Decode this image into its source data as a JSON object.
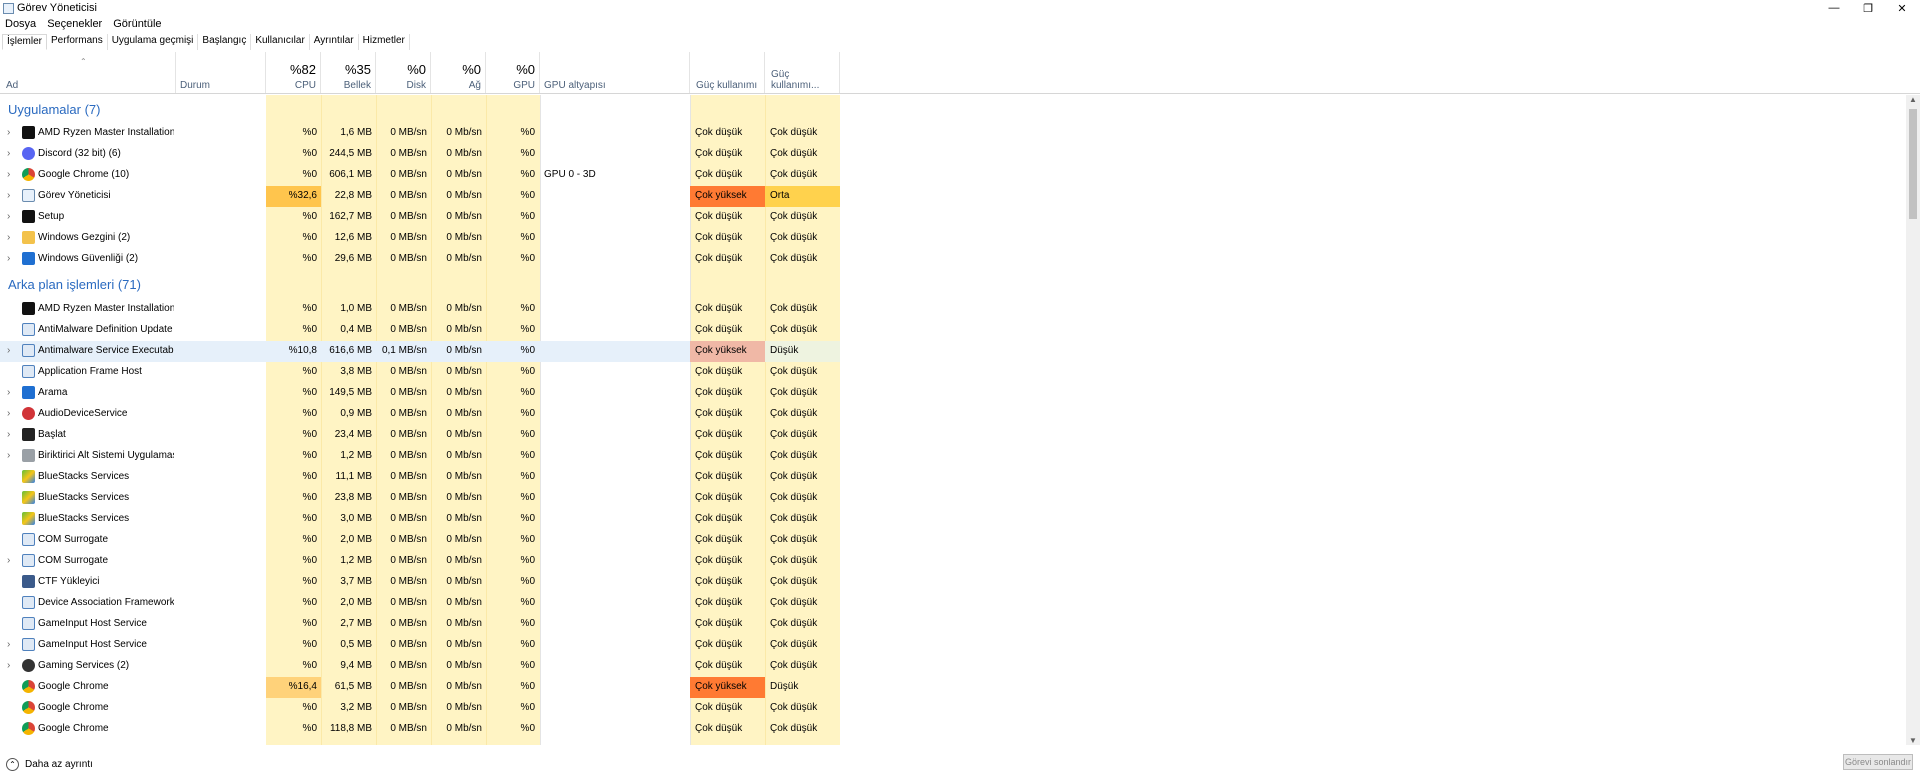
{
  "window": {
    "title": "Görev Yöneticisi",
    "minimize": "—",
    "restore": "❐",
    "close": "✕"
  },
  "menu": [
    "Dosya",
    "Seçenekler",
    "Görüntüle"
  ],
  "tabs": [
    "İşlemler",
    "Performans",
    "Uygulama geçmişi",
    "Başlangıç",
    "Kullanıcılar",
    "Ayrıntılar",
    "Hizmetler"
  ],
  "columns": {
    "name": "Ad",
    "status": "Durum",
    "cpu": {
      "pct": "%82",
      "label": "CPU"
    },
    "mem": {
      "pct": "%35",
      "label": "Bellek"
    },
    "disk": {
      "pct": "%0",
      "label": "Disk"
    },
    "net": {
      "pct": "%0",
      "label": "Ağ"
    },
    "gpu": {
      "pct": "%0",
      "label": "GPU"
    },
    "gpu_engine": "GPU altyapısı",
    "power": "Güç kullanımı",
    "power_trend": "Güç kullanımı..."
  },
  "groups": {
    "apps": "Uygulamalar (7)",
    "background": "Arka plan işlemleri (71)"
  },
  "colors": {
    "cell_light": "#fff4c4",
    "cell_mid": "#ffe08a",
    "very_high": "#ff7a33",
    "very_high_sel": "#f0b8a6",
    "medium": "#ffd24d",
    "accent": "#2a6ac0"
  },
  "apps": [
    {
      "name": "AMD Ryzen Master Installation (...",
      "cpu": "%0",
      "mem": "1,6 MB",
      "disk": "0 MB/sn",
      "net": "0 Mb/sn",
      "gpu": "%0",
      "engine": "",
      "power": "Çok düşük",
      "trend": "Çok düşük",
      "icon": "amd-icon",
      "exp": true
    },
    {
      "name": "Discord (32 bit) (6)",
      "cpu": "%0",
      "mem": "244,5 MB",
      "disk": "0 MB/sn",
      "net": "0 Mb/sn",
      "gpu": "%0",
      "engine": "",
      "power": "Çok düşük",
      "trend": "Çok düşük",
      "icon": "discord-icon",
      "exp": true
    },
    {
      "name": "Google Chrome (10)",
      "cpu": "%0",
      "mem": "606,1 MB",
      "disk": "0 MB/sn",
      "net": "0 Mb/sn",
      "gpu": "%0",
      "engine": "GPU 0 - 3D",
      "power": "Çok düşük",
      "trend": "Çok düşük",
      "icon": "chrome-icon",
      "exp": true
    },
    {
      "name": "Görev Yöneticisi",
      "cpu": "%32,6",
      "mem": "22,8 MB",
      "disk": "0 MB/sn",
      "net": "0 Mb/sn",
      "gpu": "%0",
      "engine": "",
      "power": "Çok yüksek",
      "trend": "Orta",
      "icon": "task-manager-icon",
      "exp": true,
      "hot": true,
      "trendHot": true
    },
    {
      "name": "Setup",
      "cpu": "%0",
      "mem": "162,7 MB",
      "disk": "0 MB/sn",
      "net": "0 Mb/sn",
      "gpu": "%0",
      "engine": "",
      "power": "Çok düşük",
      "trend": "Çok düşük",
      "icon": "setup-icon",
      "exp": true
    },
    {
      "name": "Windows Gezgini (2)",
      "cpu": "%0",
      "mem": "12,6 MB",
      "disk": "0 MB/sn",
      "net": "0 Mb/sn",
      "gpu": "%0",
      "engine": "",
      "power": "Çok düşük",
      "trend": "Çok düşük",
      "icon": "folder-icon",
      "exp": true
    },
    {
      "name": "Windows Güvenliği (2)",
      "cpu": "%0",
      "mem": "29,6 MB",
      "disk": "0 MB/sn",
      "net": "0 Mb/sn",
      "gpu": "%0",
      "engine": "",
      "power": "Çok düşük",
      "trend": "Çok düşük",
      "icon": "shield-icon",
      "exp": true
    }
  ],
  "background": [
    {
      "name": "AMD Ryzen Master Installation (...",
      "cpu": "%0",
      "mem": "1,0 MB",
      "disk": "0 MB/sn",
      "net": "0 Mb/sn",
      "gpu": "%0",
      "power": "Çok düşük",
      "trend": "Çok düşük",
      "icon": "amd-icon",
      "exp": false
    },
    {
      "name": "AntiMalware Definition Update",
      "cpu": "%0",
      "mem": "0,4 MB",
      "disk": "0 MB/sn",
      "net": "0 Mb/sn",
      "gpu": "%0",
      "power": "Çok düşük",
      "trend": "Çok düşük",
      "icon": "service-icon",
      "exp": false
    },
    {
      "name": "Antimalware Service Executable",
      "cpu": "%10,8",
      "mem": "616,6 MB",
      "disk": "0,1 MB/sn",
      "net": "0 Mb/sn",
      "gpu": "%0",
      "power": "Çok yüksek",
      "trend": "Düşük",
      "icon": "service-icon",
      "exp": true,
      "sel": true
    },
    {
      "name": "Application Frame Host",
      "cpu": "%0",
      "mem": "3,8 MB",
      "disk": "0 MB/sn",
      "net": "0 Mb/sn",
      "gpu": "%0",
      "power": "Çok düşük",
      "trend": "Çok düşük",
      "icon": "service-icon",
      "exp": false
    },
    {
      "name": "Arama",
      "cpu": "%0",
      "mem": "149,5 MB",
      "disk": "0 MB/sn",
      "net": "0 Mb/sn",
      "gpu": "%0",
      "power": "Çok düşük",
      "trend": "Çok düşük",
      "icon": "search-icon",
      "exp": true
    },
    {
      "name": "AudioDeviceService",
      "cpu": "%0",
      "mem": "0,9 MB",
      "disk": "0 MB/sn",
      "net": "0 Mb/sn",
      "gpu": "%0",
      "power": "Çok düşük",
      "trend": "Çok düşük",
      "icon": "headphones-icon",
      "exp": true
    },
    {
      "name": "Başlat",
      "cpu": "%0",
      "mem": "23,4 MB",
      "disk": "0 MB/sn",
      "net": "0 Mb/sn",
      "gpu": "%0",
      "power": "Çok düşük",
      "trend": "Çok düşük",
      "icon": "start-icon",
      "exp": true
    },
    {
      "name": "Biriktirici Alt Sistemi Uygulaması",
      "cpu": "%0",
      "mem": "1,2 MB",
      "disk": "0 MB/sn",
      "net": "0 Mb/sn",
      "gpu": "%0",
      "power": "Çok düşük",
      "trend": "Çok düşük",
      "icon": "printer-icon",
      "exp": true
    },
    {
      "name": "BlueStacks Services",
      "cpu": "%0",
      "mem": "11,1 MB",
      "disk": "0 MB/sn",
      "net": "0 Mb/sn",
      "gpu": "%0",
      "power": "Çok düşük",
      "trend": "Çok düşük",
      "icon": "bluestacks-icon",
      "exp": false
    },
    {
      "name": "BlueStacks Services",
      "cpu": "%0",
      "mem": "23,8 MB",
      "disk": "0 MB/sn",
      "net": "0 Mb/sn",
      "gpu": "%0",
      "power": "Çok düşük",
      "trend": "Çok düşük",
      "icon": "bluestacks-icon",
      "exp": false
    },
    {
      "name": "BlueStacks Services",
      "cpu": "%0",
      "mem": "3,0 MB",
      "disk": "0 MB/sn",
      "net": "0 Mb/sn",
      "gpu": "%0",
      "power": "Çok düşük",
      "trend": "Çok düşük",
      "icon": "bluestacks-icon",
      "exp": false
    },
    {
      "name": "COM Surrogate",
      "cpu": "%0",
      "mem": "2,0 MB",
      "disk": "0 MB/sn",
      "net": "0 Mb/sn",
      "gpu": "%0",
      "power": "Çok düşük",
      "trend": "Çok düşük",
      "icon": "service-icon",
      "exp": false
    },
    {
      "name": "COM Surrogate",
      "cpu": "%0",
      "mem": "1,2 MB",
      "disk": "0 MB/sn",
      "net": "0 Mb/sn",
      "gpu": "%0",
      "power": "Çok düşük",
      "trend": "Çok düşük",
      "icon": "service-icon",
      "exp": true
    },
    {
      "name": "CTF Yükleyici",
      "cpu": "%0",
      "mem": "3,7 MB",
      "disk": "0 MB/sn",
      "net": "0 Mb/sn",
      "gpu": "%0",
      "power": "Çok düşük",
      "trend": "Çok düşük",
      "icon": "pen-icon",
      "exp": false
    },
    {
      "name": "Device Association Framework ...",
      "cpu": "%0",
      "mem": "2,0 MB",
      "disk": "0 MB/sn",
      "net": "0 Mb/sn",
      "gpu": "%0",
      "power": "Çok düşük",
      "trend": "Çok düşük",
      "icon": "service-icon",
      "exp": false
    },
    {
      "name": "GameInput Host Service",
      "cpu": "%0",
      "mem": "2,7 MB",
      "disk": "0 MB/sn",
      "net": "0 Mb/sn",
      "gpu": "%0",
      "power": "Çok düşük",
      "trend": "Çok düşük",
      "icon": "service-icon",
      "exp": false
    },
    {
      "name": "GameInput Host Service",
      "cpu": "%0",
      "mem": "0,5 MB",
      "disk": "0 MB/sn",
      "net": "0 Mb/sn",
      "gpu": "%0",
      "power": "Çok düşük",
      "trend": "Çok düşük",
      "icon": "service-icon",
      "exp": true
    },
    {
      "name": "Gaming Services (2)",
      "cpu": "%0",
      "mem": "9,4 MB",
      "disk": "0 MB/sn",
      "net": "0 Mb/sn",
      "gpu": "%0",
      "power": "Çok düşük",
      "trend": "Çok düşük",
      "icon": "xbox-icon",
      "exp": true
    },
    {
      "name": "Google Chrome",
      "cpu": "%16,4",
      "mem": "61,5 MB",
      "disk": "0 MB/sn",
      "net": "0 Mb/sn",
      "gpu": "%0",
      "power": "Çok yüksek",
      "trend": "Düşük",
      "icon": "chrome-icon",
      "exp": false,
      "hot": true
    },
    {
      "name": "Google Chrome",
      "cpu": "%0",
      "mem": "3,2 MB",
      "disk": "0 MB/sn",
      "net": "0 Mb/sn",
      "gpu": "%0",
      "power": "Çok düşük",
      "trend": "Çok düşük",
      "icon": "chrome-icon",
      "exp": false
    },
    {
      "name": "Google Chrome",
      "cpu": "%0",
      "mem": "118,8 MB",
      "disk": "0 MB/sn",
      "net": "0 Mb/sn",
      "gpu": "%0",
      "power": "Çok düşük",
      "trend": "Çok düşük",
      "icon": "chrome-icon",
      "exp": false
    }
  ],
  "footer": {
    "less_details": "Daha az ayrıntı",
    "end_task": "Görevi sonlandır"
  }
}
